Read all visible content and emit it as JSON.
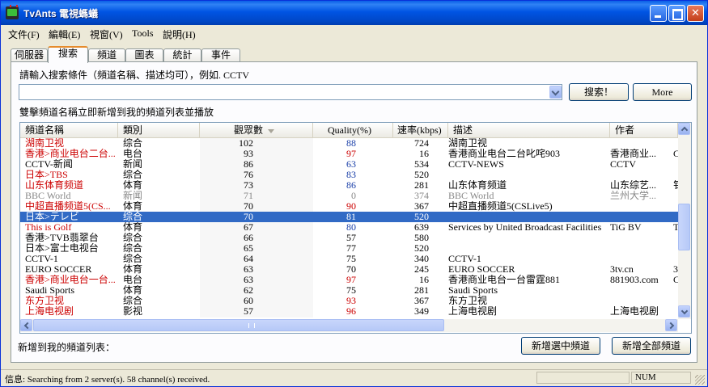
{
  "window": {
    "title": "TvAnts 電視螞蟻"
  },
  "menu": [
    "文件(F)",
    "編輯(E)",
    "視窗(V)",
    "Tools",
    "說明(H)"
  ],
  "tabs": [
    "伺服器",
    "搜索",
    "頻道",
    "圖表",
    "統計",
    "事件"
  ],
  "active_tab": "搜索",
  "search": {
    "prompt": "請輸入搜索條件（頻道名稱、描述均可），例如. CCTV",
    "value": "",
    "search_button": "搜索！",
    "more_button": "More"
  },
  "hint": "雙擊頻道名稱立即新增到我的頻道列表並播放",
  "columns": [
    "頻道名稱",
    "類別",
    "觀眾數",
    "Quality(%)",
    "速率(kbps)",
    "描述",
    "作者"
  ],
  "rows": [
    {
      "name": "湖南卫视",
      "category": "综合",
      "viewers": "102",
      "quality": "88",
      "rate": "724",
      "desc": "湖南卫视",
      "author": "",
      "extra": "",
      "style": "red",
      "qstyle": "blue"
    },
    {
      "name": "香港>商业电台二台...",
      "category": "电台",
      "viewers": "93",
      "quality": "97",
      "rate": "16",
      "desc": "香港商业电台二台叱咤903",
      "author": "香港商业...",
      "extra": "C",
      "style": "red",
      "qstyle": "red"
    },
    {
      "name": "CCTV-新闻",
      "category": "新闻",
      "viewers": "86",
      "quality": "63",
      "rate": "534",
      "desc": "CCTV-NEWS",
      "author": "CCTV",
      "extra": "",
      "style": "",
      "qstyle": "blue"
    },
    {
      "name": "日本>TBS",
      "category": "综合",
      "viewers": "76",
      "quality": "83",
      "rate": "520",
      "desc": "",
      "author": "",
      "extra": "",
      "style": "red",
      "qstyle": "blue"
    },
    {
      "name": "山东体育频道",
      "category": "体育",
      "viewers": "73",
      "quality": "86",
      "rate": "281",
      "desc": "山东体育频道",
      "author": "山东综艺...",
      "extra": "钅",
      "style": "red",
      "qstyle": "blue"
    },
    {
      "name": "BBC World",
      "category": "新闻",
      "viewers": "71",
      "quality": "0",
      "rate": "374",
      "desc": "BBC World",
      "author": "兰州大学...",
      "extra": "",
      "style": "gray",
      "qstyle": "gray"
    },
    {
      "name": "中超直播频道5(CS...",
      "category": "体育",
      "viewers": "70",
      "quality": "90",
      "rate": "367",
      "desc": "中超直播频道5(CSLive5)",
      "author": "",
      "extra": "",
      "style": "red",
      "qstyle": "red"
    },
    {
      "name": "日本>テレビ",
      "category": "综合",
      "viewers": "70",
      "quality": "81",
      "rate": "520",
      "desc": "",
      "author": "",
      "extra": "",
      "style": "selected",
      "qstyle": ""
    },
    {
      "name": "This is Golf",
      "category": "体育",
      "viewers": "67",
      "quality": "80",
      "rate": "639",
      "desc": "Services by United Broadcast Facilities",
      "author": "TiG BV",
      "extra": "T",
      "style": "red",
      "qstyle": "blue"
    },
    {
      "name": "香港>TVB翡翠台",
      "category": "综合",
      "viewers": "66",
      "quality": "57",
      "rate": "580",
      "desc": "",
      "author": "",
      "extra": "",
      "style": "",
      "qstyle": ""
    },
    {
      "name": "日本>富士电视台",
      "category": "综合",
      "viewers": "65",
      "quality": "77",
      "rate": "520",
      "desc": "",
      "author": "",
      "extra": "",
      "style": "",
      "qstyle": ""
    },
    {
      "name": "CCTV-1",
      "category": "综合",
      "viewers": "64",
      "quality": "75",
      "rate": "340",
      "desc": "CCTV-1",
      "author": "",
      "extra": "",
      "style": "",
      "qstyle": ""
    },
    {
      "name": "EURO SOCCER",
      "category": "体育",
      "viewers": "63",
      "quality": "70",
      "rate": "245",
      "desc": "EURO SOCCER",
      "author": "3tv.cn",
      "extra": "3",
      "style": "",
      "qstyle": ""
    },
    {
      "name": "香港>商业电台一台...",
      "category": "电台",
      "viewers": "63",
      "quality": "97",
      "rate": "16",
      "desc": "香港商业电台一台雷霆881",
      "author": "881903.com",
      "extra": "C",
      "style": "red",
      "qstyle": "red"
    },
    {
      "name": "Saudi Sports",
      "category": "体育",
      "viewers": "62",
      "quality": "75",
      "rate": "281",
      "desc": "Saudi Sports",
      "author": "",
      "extra": "",
      "style": "",
      "qstyle": ""
    },
    {
      "name": "东方卫视",
      "category": "综合",
      "viewers": "60",
      "quality": "93",
      "rate": "367",
      "desc": "东方卫视",
      "author": "",
      "extra": "",
      "style": "red",
      "qstyle": "red"
    },
    {
      "name": "上海电视剧",
      "category": "影视",
      "viewers": "57",
      "quality": "96",
      "rate": "349",
      "desc": "上海电视剧",
      "author": "上海电视剧",
      "extra": "",
      "style": "red",
      "qstyle": "red"
    }
  ],
  "add_label": "新增到我的頻道列表：",
  "add_selected_button": "新增選中頻道",
  "add_all_button": "新增全部頻道",
  "status": {
    "text": "信息: Searching  from 2 server(s). 58 channel(s) received.",
    "num": "NUM"
  }
}
